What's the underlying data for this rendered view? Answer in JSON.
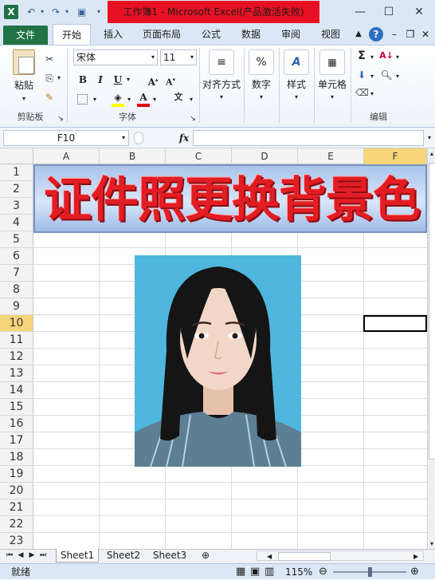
{
  "window": {
    "title": "工作簿1 - Microsoft Excel(产品激活失败)",
    "title_bg": "#e81123",
    "minimize": "—",
    "maximize": "☐",
    "close": "✕"
  },
  "ribbon": {
    "tabs": [
      "文件",
      "开始",
      "插入",
      "页面布局",
      "公式",
      "数据",
      "审阅",
      "视图"
    ],
    "clipboard": {
      "paste": "粘贴",
      "group": "剪贴板"
    },
    "font": {
      "name": "宋体",
      "size": "11",
      "bold": "B",
      "italic": "I",
      "underline": "U",
      "group": "字体"
    },
    "alignment": {
      "label": "对齐方式"
    },
    "number": {
      "label": "数字",
      "icon_text": "%"
    },
    "styles": {
      "label": "样式"
    },
    "cells": {
      "label": "单元格"
    },
    "editing": {
      "group": "编辑",
      "sigma": "Σ"
    }
  },
  "formula_bar": {
    "name_box": "F10",
    "fx": "fx",
    "content": ""
  },
  "grid": {
    "columns": [
      "A",
      "B",
      "C",
      "D",
      "E",
      "F"
    ],
    "rows": [
      "1",
      "2",
      "3",
      "4",
      "5",
      "6",
      "7",
      "8",
      "9",
      "10",
      "11",
      "12",
      "13",
      "14",
      "15",
      "16",
      "17",
      "18",
      "19",
      "20",
      "21",
      "22",
      "23"
    ],
    "active_cell": "F10",
    "active_color": "#f7d579"
  },
  "banner": {
    "text": "证件照更换背景色",
    "text_color": "#e21d24"
  },
  "photo": {
    "background_color": "#4fb7dd"
  },
  "sheets": {
    "tabs": [
      "Sheet1",
      "Sheet2",
      "Sheet3"
    ],
    "active": "Sheet1"
  },
  "status": {
    "ready": "就绪",
    "zoom": "115%"
  }
}
